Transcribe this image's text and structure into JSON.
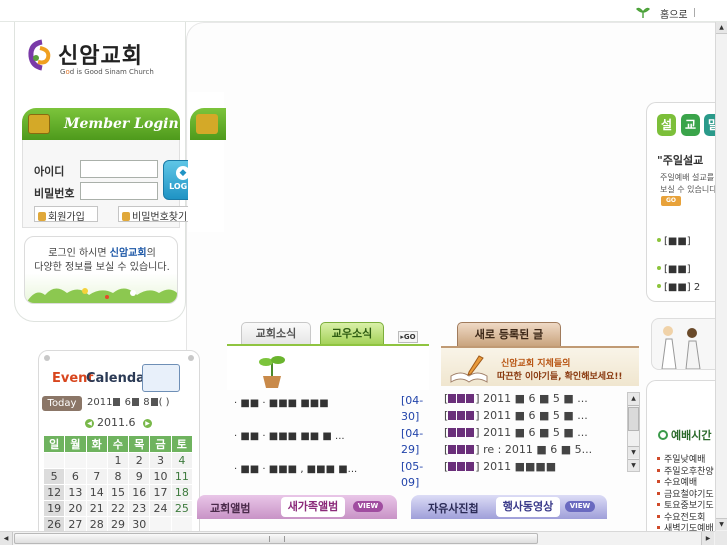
{
  "topbar": {
    "home_label": "홈으로"
  },
  "logo": {
    "title": "신암교회",
    "sub_prefix": "G",
    "sub_o": "o",
    "sub_rest": "d is Good  Sinam Church"
  },
  "login": {
    "tab_label": "Member Login",
    "id_label": "아이디",
    "pw_label": "비밀번호",
    "button_label": "LOGIN",
    "join_label": "회원가입",
    "find_label": "비밀번호찾기"
  },
  "notice": {
    "line1_prefix": "로그인 하시면 ",
    "church_name": "신암교회",
    "line1_suffix": "의",
    "line2": "다양한 정보를 보실 수 있습니다."
  },
  "calendar": {
    "title_event": "Event",
    "title_calendar": "Calendar",
    "today_label": "Today",
    "today_year": "2011",
    "today_month": "6",
    "today_day": "8",
    "today_paren": "( )",
    "month_label": "2011.6",
    "weekdays": [
      "일",
      "월",
      "화",
      "수",
      "목",
      "금",
      "토"
    ],
    "rows": [
      [
        "",
        "",
        "",
        "1",
        "2",
        "3",
        "4"
      ],
      [
        "5",
        "6",
        "7",
        "8",
        "9",
        "10",
        "11"
      ],
      [
        "12",
        "13",
        "14",
        "15",
        "16",
        "17",
        "18"
      ],
      [
        "19",
        "20",
        "21",
        "22",
        "23",
        "24",
        "25"
      ],
      [
        "26",
        "27",
        "28",
        "29",
        "30",
        "",
        ""
      ]
    ]
  },
  "news": {
    "tab_church": "교회소식",
    "tab_member": "교우소식",
    "go_label": "GO",
    "items": [
      {
        "text": "· ■■ · ■■■ ■■■",
        "date": "[04-30]"
      },
      {
        "text": "· ■■ · ■■■ ■■ ■ ...",
        "date": "[04-29]"
      },
      {
        "text": "· ■■ · ■■■ , ■■■ ■...",
        "date": "[05-09]"
      }
    ]
  },
  "posts": {
    "tab_label": "새로 등록된 글",
    "banner_line1": "신암교회 지체들의",
    "banner_line2": "따끈한 이야기들, 확인해보세요!!",
    "items": [
      "2011 ■ 6 ■ 5 ■ ...",
      "2011 ■ 6 ■ 5 ■ ...",
      "2011 ■ 6 ■ 5 ■ ...",
      "re : 2011 ■ 6 ■ 5...",
      "2011 ■■■■"
    ]
  },
  "albums": {
    "church_album": "교회앨범",
    "family_album": "새가족앨범",
    "view_label": "VIEW",
    "free_photo": "자유사진첩",
    "event_video": "행사동영상"
  },
  "sermon": {
    "tabs": [
      "설",
      "교",
      "말"
    ],
    "quote": "\"주일설교",
    "desc1": "주일예배 설교를",
    "desc2": "보실 수 있습니다",
    "go_label": "GO",
    "items": [
      "[■■]",
      "[■■]",
      "[■■] 2"
    ]
  },
  "worship": {
    "title": "예배시간",
    "items": [
      "주일낮예배",
      "주일오후찬양",
      "수요예배",
      "금요철야기도",
      "토요중보기도",
      "수요전도회",
      "새벽기도예배"
    ]
  }
}
